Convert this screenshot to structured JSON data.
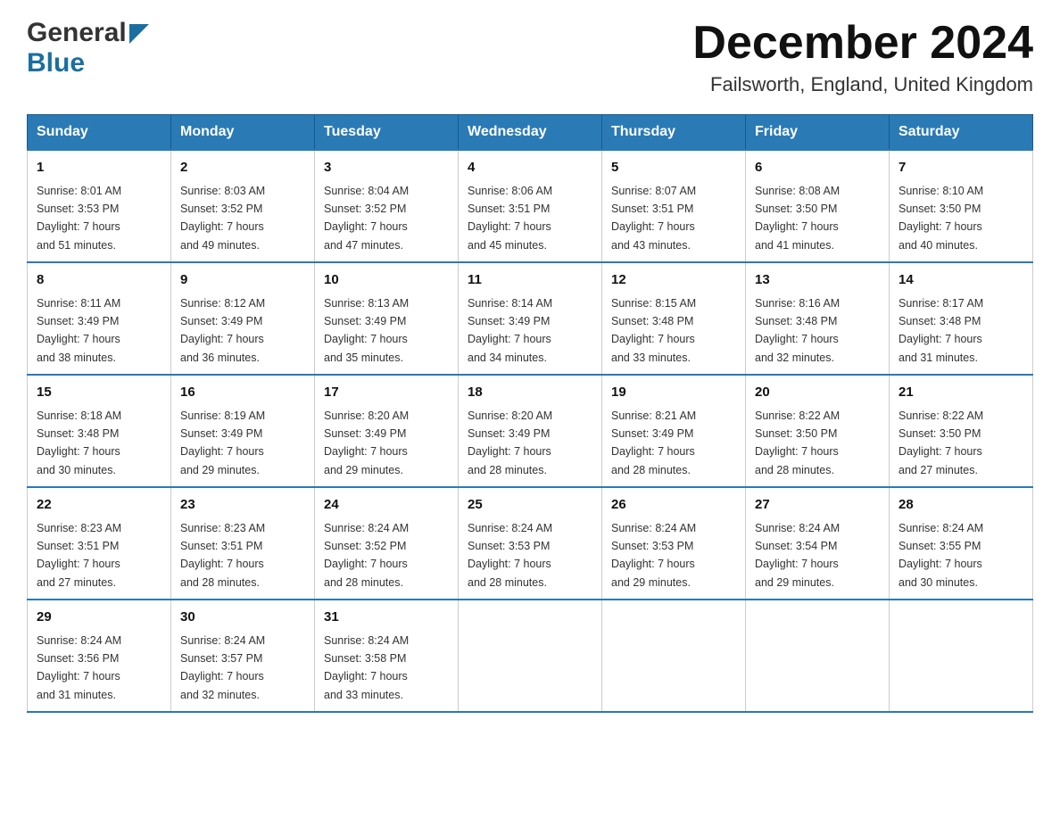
{
  "header": {
    "logo_general": "General",
    "logo_blue": "Blue",
    "month_title": "December 2024",
    "subtitle": "Failsworth, England, United Kingdom"
  },
  "weekdays": [
    "Sunday",
    "Monday",
    "Tuesday",
    "Wednesday",
    "Thursday",
    "Friday",
    "Saturday"
  ],
  "weeks": [
    [
      {
        "day": "1",
        "sunrise": "8:01 AM",
        "sunset": "3:53 PM",
        "daylight": "7 hours and 51 minutes."
      },
      {
        "day": "2",
        "sunrise": "8:03 AM",
        "sunset": "3:52 PM",
        "daylight": "7 hours and 49 minutes."
      },
      {
        "day": "3",
        "sunrise": "8:04 AM",
        "sunset": "3:52 PM",
        "daylight": "7 hours and 47 minutes."
      },
      {
        "day": "4",
        "sunrise": "8:06 AM",
        "sunset": "3:51 PM",
        "daylight": "7 hours and 45 minutes."
      },
      {
        "day": "5",
        "sunrise": "8:07 AM",
        "sunset": "3:51 PM",
        "daylight": "7 hours and 43 minutes."
      },
      {
        "day": "6",
        "sunrise": "8:08 AM",
        "sunset": "3:50 PM",
        "daylight": "7 hours and 41 minutes."
      },
      {
        "day": "7",
        "sunrise": "8:10 AM",
        "sunset": "3:50 PM",
        "daylight": "7 hours and 40 minutes."
      }
    ],
    [
      {
        "day": "8",
        "sunrise": "8:11 AM",
        "sunset": "3:49 PM",
        "daylight": "7 hours and 38 minutes."
      },
      {
        "day": "9",
        "sunrise": "8:12 AM",
        "sunset": "3:49 PM",
        "daylight": "7 hours and 36 minutes."
      },
      {
        "day": "10",
        "sunrise": "8:13 AM",
        "sunset": "3:49 PM",
        "daylight": "7 hours and 35 minutes."
      },
      {
        "day": "11",
        "sunrise": "8:14 AM",
        "sunset": "3:49 PM",
        "daylight": "7 hours and 34 minutes."
      },
      {
        "day": "12",
        "sunrise": "8:15 AM",
        "sunset": "3:48 PM",
        "daylight": "7 hours and 33 minutes."
      },
      {
        "day": "13",
        "sunrise": "8:16 AM",
        "sunset": "3:48 PM",
        "daylight": "7 hours and 32 minutes."
      },
      {
        "day": "14",
        "sunrise": "8:17 AM",
        "sunset": "3:48 PM",
        "daylight": "7 hours and 31 minutes."
      }
    ],
    [
      {
        "day": "15",
        "sunrise": "8:18 AM",
        "sunset": "3:48 PM",
        "daylight": "7 hours and 30 minutes."
      },
      {
        "day": "16",
        "sunrise": "8:19 AM",
        "sunset": "3:49 PM",
        "daylight": "7 hours and 29 minutes."
      },
      {
        "day": "17",
        "sunrise": "8:20 AM",
        "sunset": "3:49 PM",
        "daylight": "7 hours and 29 minutes."
      },
      {
        "day": "18",
        "sunrise": "8:20 AM",
        "sunset": "3:49 PM",
        "daylight": "7 hours and 28 minutes."
      },
      {
        "day": "19",
        "sunrise": "8:21 AM",
        "sunset": "3:49 PM",
        "daylight": "7 hours and 28 minutes."
      },
      {
        "day": "20",
        "sunrise": "8:22 AM",
        "sunset": "3:50 PM",
        "daylight": "7 hours and 28 minutes."
      },
      {
        "day": "21",
        "sunrise": "8:22 AM",
        "sunset": "3:50 PM",
        "daylight": "7 hours and 27 minutes."
      }
    ],
    [
      {
        "day": "22",
        "sunrise": "8:23 AM",
        "sunset": "3:51 PM",
        "daylight": "7 hours and 27 minutes."
      },
      {
        "day": "23",
        "sunrise": "8:23 AM",
        "sunset": "3:51 PM",
        "daylight": "7 hours and 28 minutes."
      },
      {
        "day": "24",
        "sunrise": "8:24 AM",
        "sunset": "3:52 PM",
        "daylight": "7 hours and 28 minutes."
      },
      {
        "day": "25",
        "sunrise": "8:24 AM",
        "sunset": "3:53 PM",
        "daylight": "7 hours and 28 minutes."
      },
      {
        "day": "26",
        "sunrise": "8:24 AM",
        "sunset": "3:53 PM",
        "daylight": "7 hours and 29 minutes."
      },
      {
        "day": "27",
        "sunrise": "8:24 AM",
        "sunset": "3:54 PM",
        "daylight": "7 hours and 29 minutes."
      },
      {
        "day": "28",
        "sunrise": "8:24 AM",
        "sunset": "3:55 PM",
        "daylight": "7 hours and 30 minutes."
      }
    ],
    [
      {
        "day": "29",
        "sunrise": "8:24 AM",
        "sunset": "3:56 PM",
        "daylight": "7 hours and 31 minutes."
      },
      {
        "day": "30",
        "sunrise": "8:24 AM",
        "sunset": "3:57 PM",
        "daylight": "7 hours and 32 minutes."
      },
      {
        "day": "31",
        "sunrise": "8:24 AM",
        "sunset": "3:58 PM",
        "daylight": "7 hours and 33 minutes."
      },
      null,
      null,
      null,
      null
    ]
  ],
  "sunrise_label": "Sunrise: ",
  "sunset_label": "Sunset: ",
  "daylight_label": "Daylight: "
}
